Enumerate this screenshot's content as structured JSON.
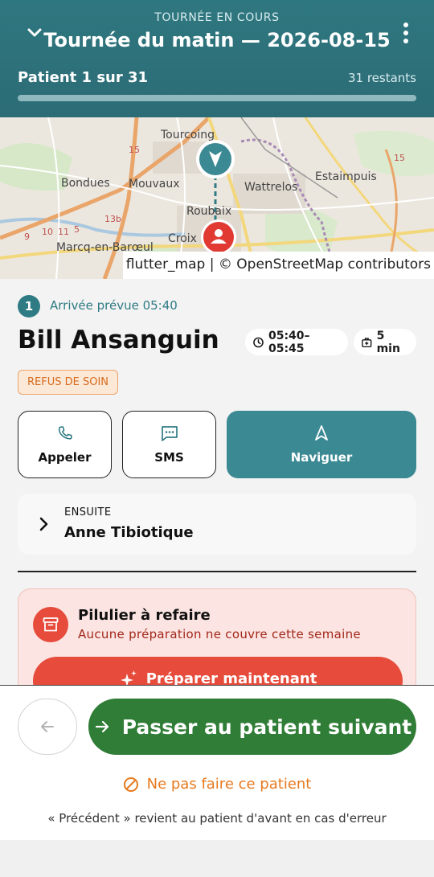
{
  "header": {
    "subtitle": "TOURNÉE EN COURS",
    "title": "Tournée du matin — 2026-08-15",
    "progress_label": "Patient 1 sur 31",
    "remaining": "31 restants",
    "progress_fraction": 0.0
  },
  "map": {
    "labels": [
      "Tourcoing",
      "Bondues",
      "Mouvaux",
      "Wattrelos",
      "Estaimpuis",
      "Roubaix",
      "Croix",
      "Marcq-en-Barœul"
    ],
    "road_numbers": [
      "15",
      "13b",
      "9",
      "10",
      "11",
      "5",
      "15"
    ],
    "attribution": "flutter_map | © OpenStreetMap contributors"
  },
  "visit": {
    "number": "1",
    "arrival": "Arrivée prévue 05:40",
    "patient_name": "Bill Ansanguin",
    "time_range": "05:40–05:45",
    "duration": "5 min",
    "tag": "REFUS DE SOIN"
  },
  "actions": {
    "call": "Appeler",
    "sms": "SMS",
    "navigate": "Naviguer"
  },
  "next_patient": {
    "label": "ENSUITE",
    "name": "Anne Tibiotique"
  },
  "alert": {
    "title": "Pilulier à refaire",
    "text": "Aucune préparation ne couvre cette semaine",
    "button": "Préparer maintenant"
  },
  "bottom": {
    "next_button": "Passer au patient suivant",
    "skip": "Ne pas faire ce patient",
    "hint": "« Précédent » revient au patient d'avant en cas d'erreur"
  },
  "colors": {
    "header": "#2f7780",
    "accent_teal": "#3b8993",
    "danger": "#e64b3b",
    "success": "#2f7d36",
    "warning": "#e77a1f"
  }
}
